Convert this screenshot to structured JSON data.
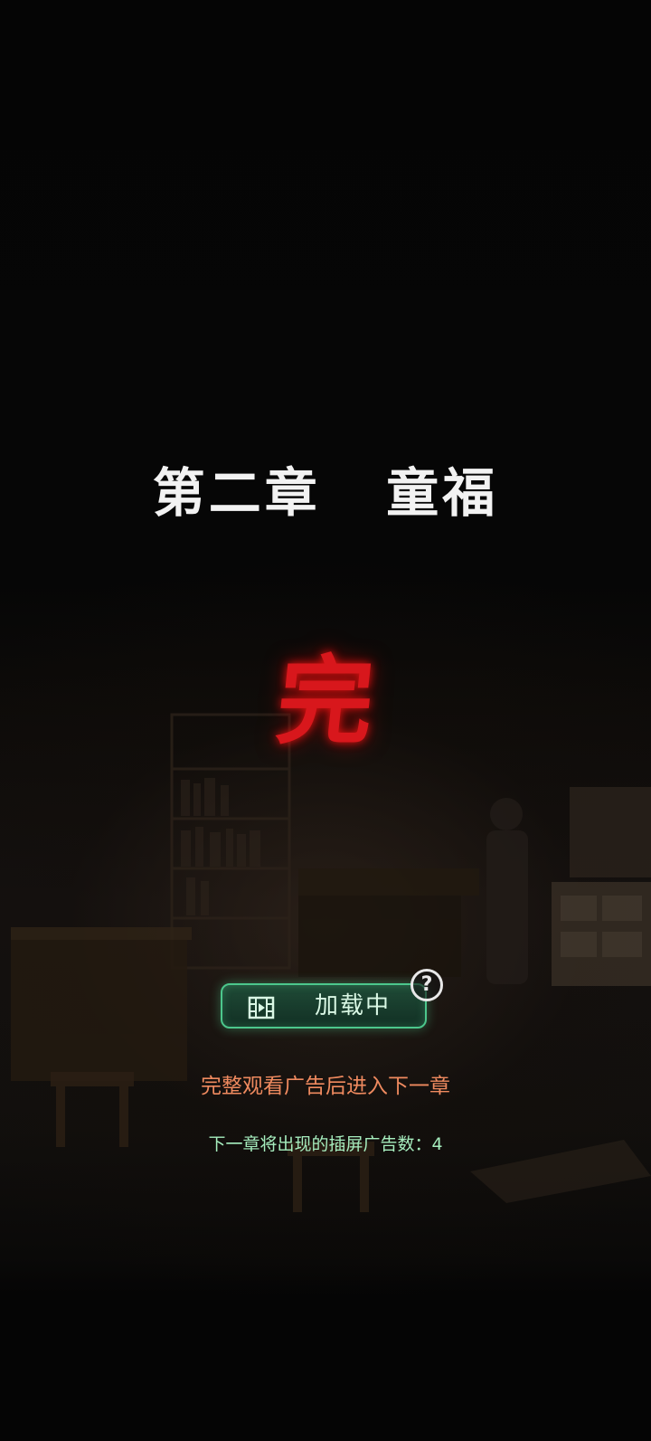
{
  "chapter": {
    "title": "第二章   童福"
  },
  "end_mark": "完",
  "loading_button": {
    "label": "加载中",
    "icon": "film-icon"
  },
  "help_icon": {
    "glyph": "?"
  },
  "ad_hint": "完整观看广告后进入下一章",
  "ad_count": "下一章将出现的插屏广告数：4",
  "colors": {
    "title": "#f2f2f2",
    "end_mark": "#d8171c",
    "button_border": "#4cc78c",
    "ad_hint": "#ef8a5f",
    "ad_count": "#a6edbe"
  }
}
